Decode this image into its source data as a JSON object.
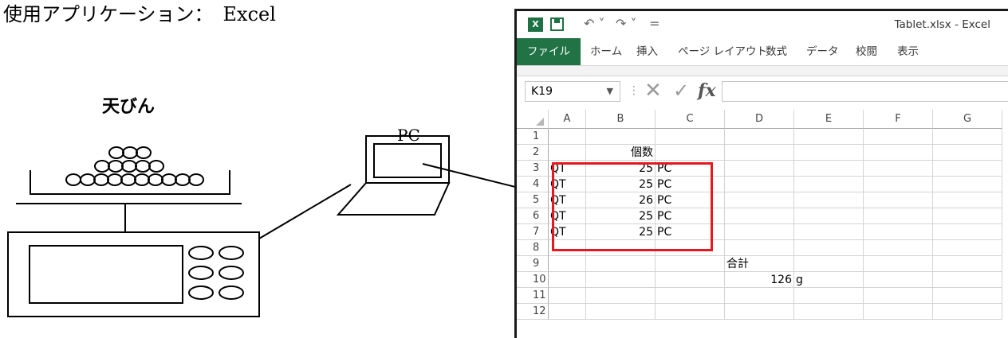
{
  "header": {
    "app_label": "使用アプリケーション：　Excel"
  },
  "balance": {
    "label": "天びん"
  },
  "pc": {
    "label": "PC"
  },
  "excel": {
    "logo_text": "X",
    "doc_title": "Tablet.xlsx - Excel",
    "undo_glyph": "↶ ˅",
    "redo_glyph": "↷ ˅",
    "customize_glyph": "=",
    "tabs": [
      "ファイル",
      "ホーム",
      "挿入",
      "ページ レイアウト",
      "数式",
      "データ",
      "校閲",
      "表示"
    ],
    "name_box": "K19",
    "fx_label": "fx",
    "columns": [
      "A",
      "B",
      "C",
      "D",
      "E",
      "F",
      "G"
    ],
    "rows": [
      "1",
      "2",
      "3",
      "4",
      "5",
      "6",
      "7",
      "8",
      "9",
      "10",
      "11",
      "12"
    ],
    "cells": {
      "b2": "個数",
      "data_rows": [
        {
          "a": "QT",
          "b": "25",
          "c": "PC"
        },
        {
          "a": "QT",
          "b": "25",
          "c": "PC"
        },
        {
          "a": "QT",
          "b": "26",
          "c": "PC"
        },
        {
          "a": "QT",
          "b": "25",
          "c": "PC"
        },
        {
          "a": "QT",
          "b": "25",
          "c": "PC"
        }
      ],
      "d9": "合計",
      "d10": "126",
      "e10": "g"
    },
    "highlight_color": "#e8171d"
  }
}
